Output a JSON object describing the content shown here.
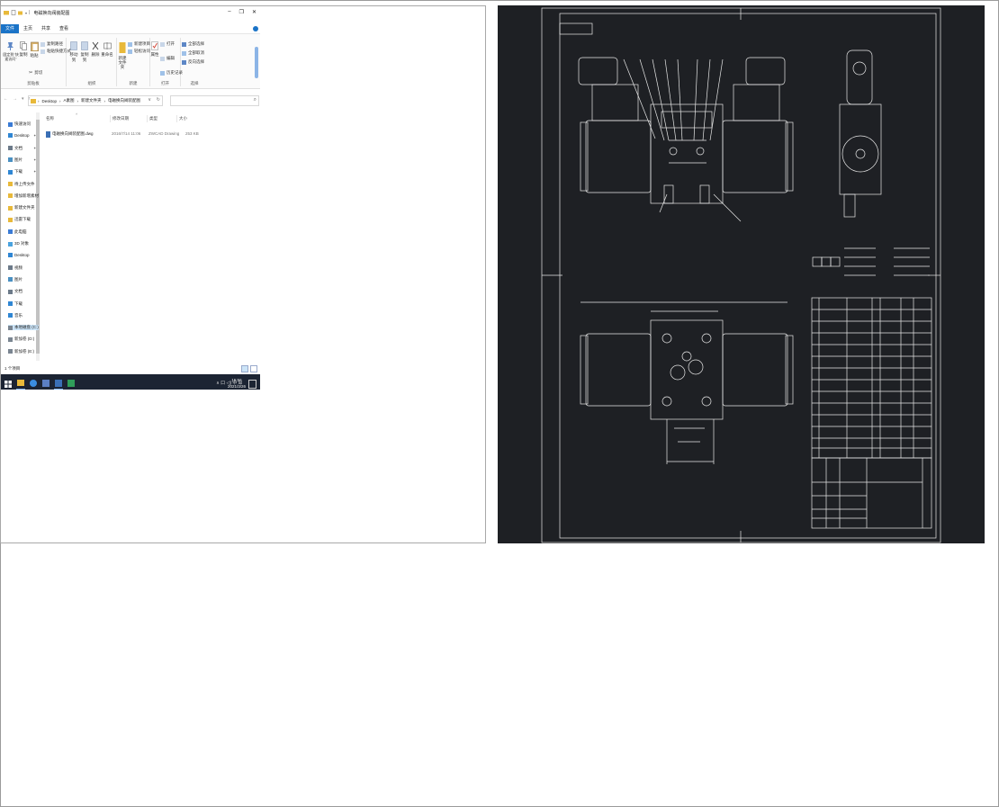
{
  "window": {
    "title": "电磁换向阀装配图",
    "controls": [
      "–",
      "❐",
      "✕"
    ]
  },
  "ribbon": {
    "tabs": [
      "文件",
      "主页",
      "共享",
      "查看"
    ],
    "groups": {
      "clipboard": {
        "label": "剪贴板",
        "pin_label": "固定到\"快速访问\"",
        "copy": "复制",
        "paste": "粘贴",
        "copy_path": "复制路径",
        "paste_shortcut": "粘贴快捷方式",
        "cut": "剪切"
      },
      "organize": {
        "label": "组织",
        "move_to": "移动到",
        "copy_to": "复制到",
        "delete": "删除",
        "rename": "重命名"
      },
      "new": {
        "label": "新建",
        "new_item": "新建项目",
        "easy_access": "轻松访问",
        "new_folder": "新建文件夹"
      },
      "open": {
        "label": "打开",
        "open": "打开",
        "edit": "编辑",
        "history": "历史记录",
        "properties": "属性"
      },
      "select": {
        "label": "选择",
        "select_all": "全部选择",
        "select_none": "全部取消",
        "invert": "反向选择"
      }
    }
  },
  "address": {
    "path": [
      "Desktop",
      "A素图",
      "新建文件夹",
      "电磁换向阀装配图"
    ]
  },
  "nav": {
    "items": [
      {
        "label": "快速访问",
        "icon": "star-icon",
        "color": "#3a7bd5"
      },
      {
        "label": "Desktop",
        "icon": "desktop-icon",
        "color": "#2f86d3",
        "pinned": true
      },
      {
        "label": "文档",
        "icon": "document-icon",
        "color": "#6c7a89",
        "pinned": true
      },
      {
        "label": "图片",
        "icon": "picture-icon",
        "color": "#4a90c2",
        "pinned": true
      },
      {
        "label": "下载",
        "icon": "download-icon",
        "color": "#2f86d3",
        "pinned": true
      },
      {
        "label": "待上传文件",
        "icon": "folder-icon",
        "color": "#e8b93a"
      },
      {
        "label": "增加新增素材",
        "icon": "folder-icon",
        "color": "#e8b93a"
      },
      {
        "label": "新建文件夹",
        "icon": "folder-icon",
        "color": "#e8b93a"
      },
      {
        "label": "迅雷下载",
        "icon": "folder-icon",
        "color": "#e8b93a"
      },
      {
        "label": "此电脑",
        "icon": "computer-icon",
        "color": "#3a7bd5"
      },
      {
        "label": "3D 对象",
        "icon": "cube-icon",
        "color": "#4aa3df"
      },
      {
        "label": "Desktop",
        "icon": "desktop-icon",
        "color": "#2f86d3"
      },
      {
        "label": "视频",
        "icon": "video-icon",
        "color": "#6c7a89"
      },
      {
        "label": "图片",
        "icon": "picture-icon",
        "color": "#4a90c2"
      },
      {
        "label": "文档",
        "icon": "document-icon",
        "color": "#6c7a89"
      },
      {
        "label": "下载",
        "icon": "download-icon",
        "color": "#2f86d3"
      },
      {
        "label": "音乐",
        "icon": "music-icon",
        "color": "#2f86d3"
      },
      {
        "label": "本地磁盘 (C:)",
        "icon": "drive-icon",
        "color": "#7a8591",
        "selected": true
      },
      {
        "label": "新加卷 (D:)",
        "icon": "drive-icon",
        "color": "#7a8591"
      },
      {
        "label": "新加卷 (E:)",
        "icon": "drive-icon",
        "color": "#7a8591"
      }
    ]
  },
  "file_list": {
    "columns": [
      "名称",
      "修改日期",
      "类型",
      "大小"
    ],
    "rows": [
      {
        "name": "电磁换向阀装配图.dwg",
        "modified": "2016/7/14 11:06",
        "type": "ZWCAD Drawing",
        "size": "253 KB"
      }
    ]
  },
  "status": {
    "count": "1 个项目"
  },
  "taskbar": {
    "time": "15:56",
    "date": "2021/3/26",
    "tray": "∧ 口 ◁) 中 ⊞"
  },
  "colors": {
    "accent": "#1a73c7",
    "taskbar": "#1c2433",
    "cad_bg": "#1e2024",
    "cad_line": "#e8e8e8"
  }
}
